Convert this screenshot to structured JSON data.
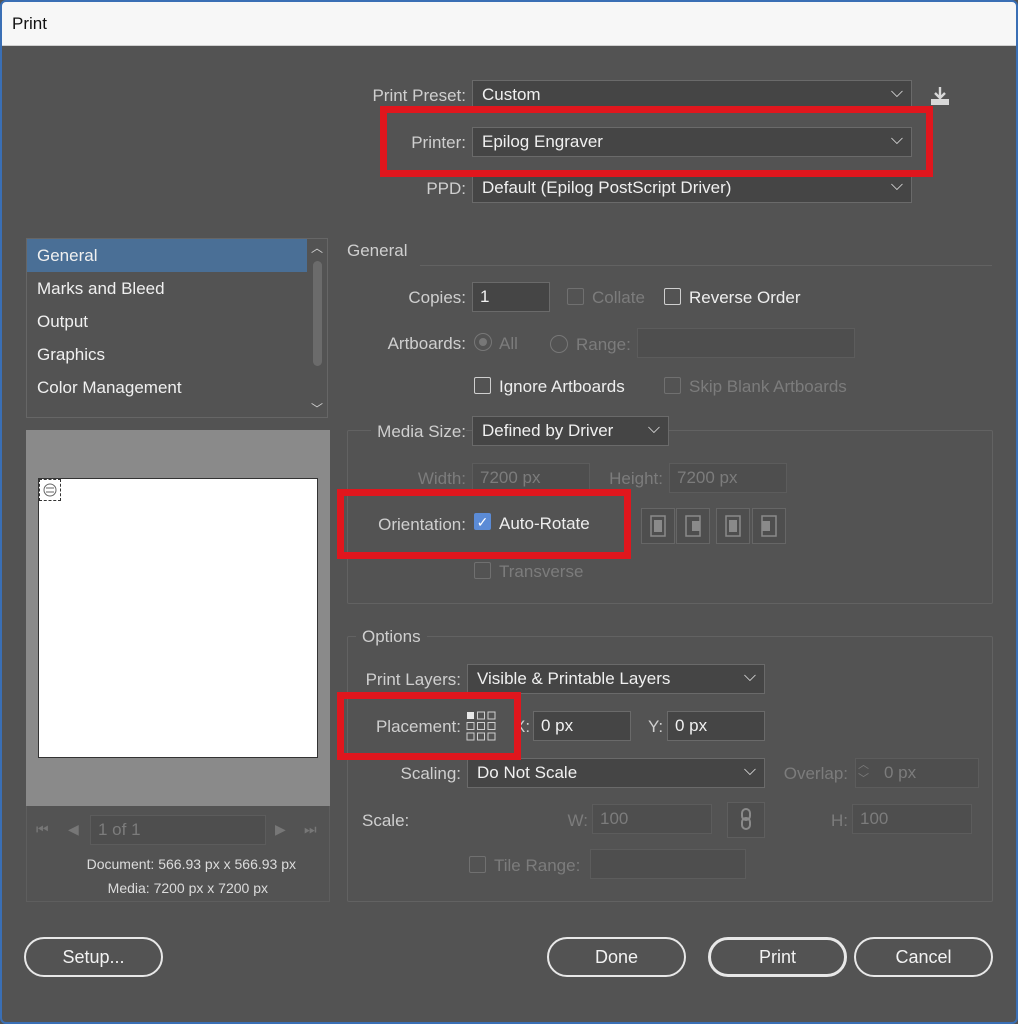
{
  "window": {
    "title": "Print"
  },
  "preset": {
    "label": "Print Preset:",
    "value": "Custom"
  },
  "printer": {
    "label": "Printer:",
    "value": "Epilog Engraver"
  },
  "ppd": {
    "label": "PPD:",
    "value": "Default (Epilog PostScript Driver)"
  },
  "nav": {
    "items": [
      {
        "label": "General",
        "selected": true
      },
      {
        "label": "Marks and Bleed"
      },
      {
        "label": "Output"
      },
      {
        "label": "Graphics"
      },
      {
        "label": "Color Management"
      }
    ]
  },
  "preview": {
    "page_indicator": "1 of 1",
    "document_label": "Document:",
    "document_size": "566.93 px x 566.93 px",
    "media_label": "Media:",
    "media_size": "7200 px x 7200 px"
  },
  "general": {
    "heading": "General",
    "copies_label": "Copies:",
    "copies_value": "1",
    "collate_label": "Collate",
    "reverse_order_label": "Reverse Order",
    "artboards_label": "Artboards:",
    "all_label": "All",
    "range_label": "Range:",
    "ignore_artboards_label": "Ignore Artboards",
    "skip_blank_label": "Skip Blank Artboards",
    "media_size_label": "Media Size:",
    "media_size_value": "Defined by Driver",
    "width_label": "Width:",
    "width_value": "7200 px",
    "height_label": "Height:",
    "height_value": "7200 px",
    "orientation_label": "Orientation:",
    "auto_rotate_label": "Auto-Rotate",
    "auto_rotate_checked": true,
    "transverse_label": "Transverse"
  },
  "options": {
    "heading": "Options",
    "print_layers_label": "Print Layers:",
    "print_layers_value": "Visible & Printable Layers",
    "placement_label": "Placement:",
    "x_label": "X:",
    "x_value": "0 px",
    "y_label": "Y:",
    "y_value": "0 px",
    "scaling_label": "Scaling:",
    "scaling_value": "Do Not Scale",
    "overlap_label": "Overlap:",
    "overlap_value": "0 px",
    "scale_label": "Scale:",
    "w_label": "W:",
    "w_value": "100",
    "h_label": "H:",
    "h_value": "100",
    "tile_range_label": "Tile Range:"
  },
  "buttons": {
    "setup": "Setup...",
    "done": "Done",
    "print": "Print",
    "cancel": "Cancel"
  },
  "colors": {
    "dialog_bg": "#535353",
    "highlight_red": "#e0161d",
    "selection_blue": "#4a6f96",
    "checkbox_blue": "#5b8bd6"
  }
}
